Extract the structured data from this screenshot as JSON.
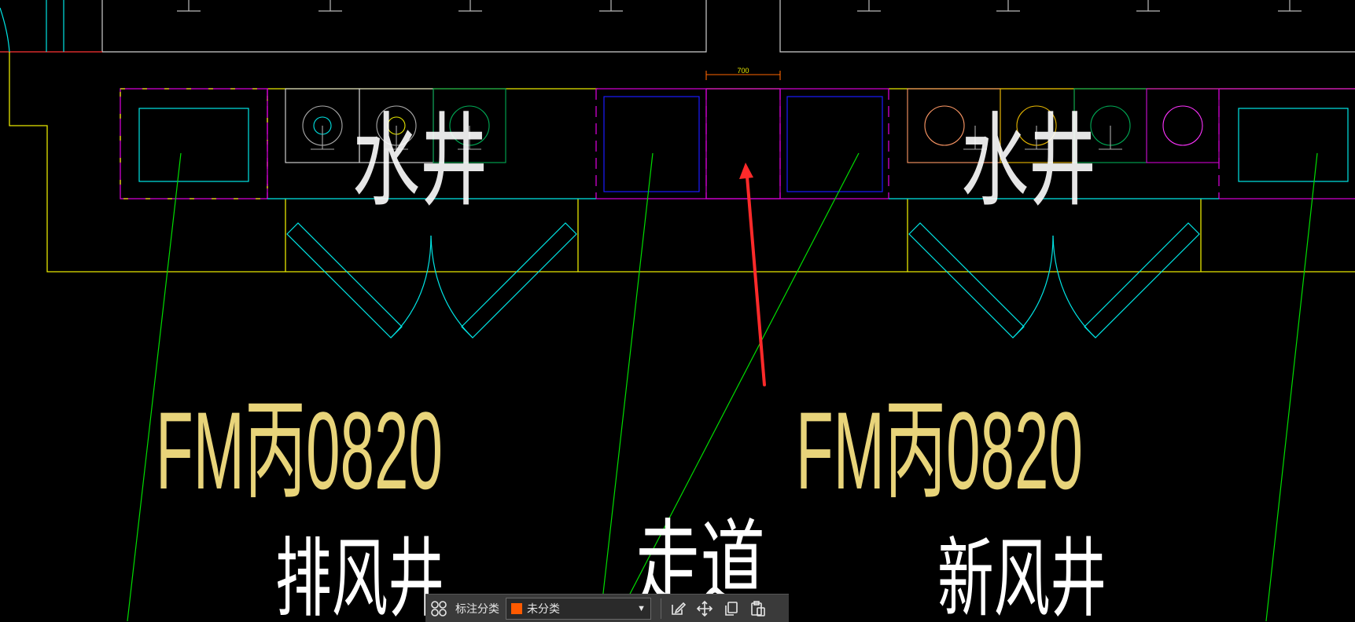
{
  "drawing": {
    "dimension_text": "700",
    "door_labels": [
      "FM丙0820",
      "FM丙0820"
    ],
    "room_labels": [
      "排风井",
      "走道",
      "新风井"
    ],
    "shaft_labels": [
      "水井",
      "水井"
    ]
  },
  "toolbar": {
    "label": "标注分类",
    "select_value": "未分类",
    "swatch_color": "#ff5a00",
    "icons": [
      "grid-icon",
      "edit-icon",
      "move-icon",
      "copy-icon",
      "paste-icon"
    ]
  },
  "colors": {
    "background": "#000000",
    "yellow": "#e8e800",
    "cyan": "#00e5e5",
    "green": "#00ff00",
    "magenta": "#d000d0",
    "blue": "#0000ff",
    "red": "#ff2a2a",
    "white": "#ffffff",
    "text_yellow": "#e8d47a"
  }
}
